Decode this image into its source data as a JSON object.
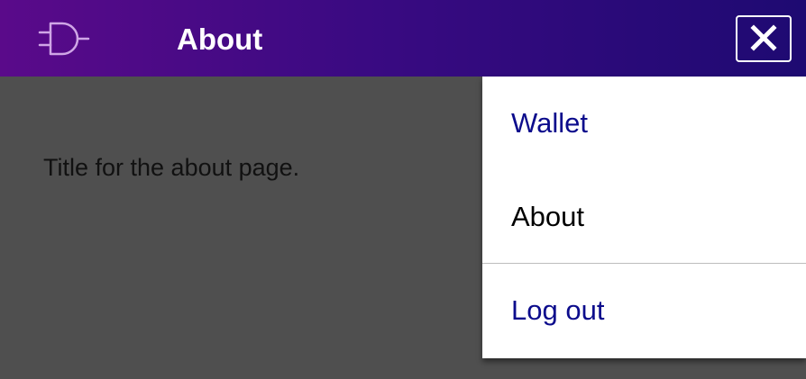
{
  "header": {
    "logo_icon": "logic-gate-icon",
    "title": "About",
    "close_icon": "close-icon"
  },
  "content": {
    "text": "Title for the about page."
  },
  "menu": {
    "items": [
      {
        "label": "Wallet",
        "state": "link"
      },
      {
        "label": "About",
        "state": "active"
      },
      {
        "label": "Log out",
        "state": "link"
      }
    ]
  },
  "colors": {
    "header_gradient_start": "#5a0a8a",
    "header_gradient_end": "#1e0a72",
    "link": "#0c0c8c",
    "overlay": "#4f4f4f"
  }
}
